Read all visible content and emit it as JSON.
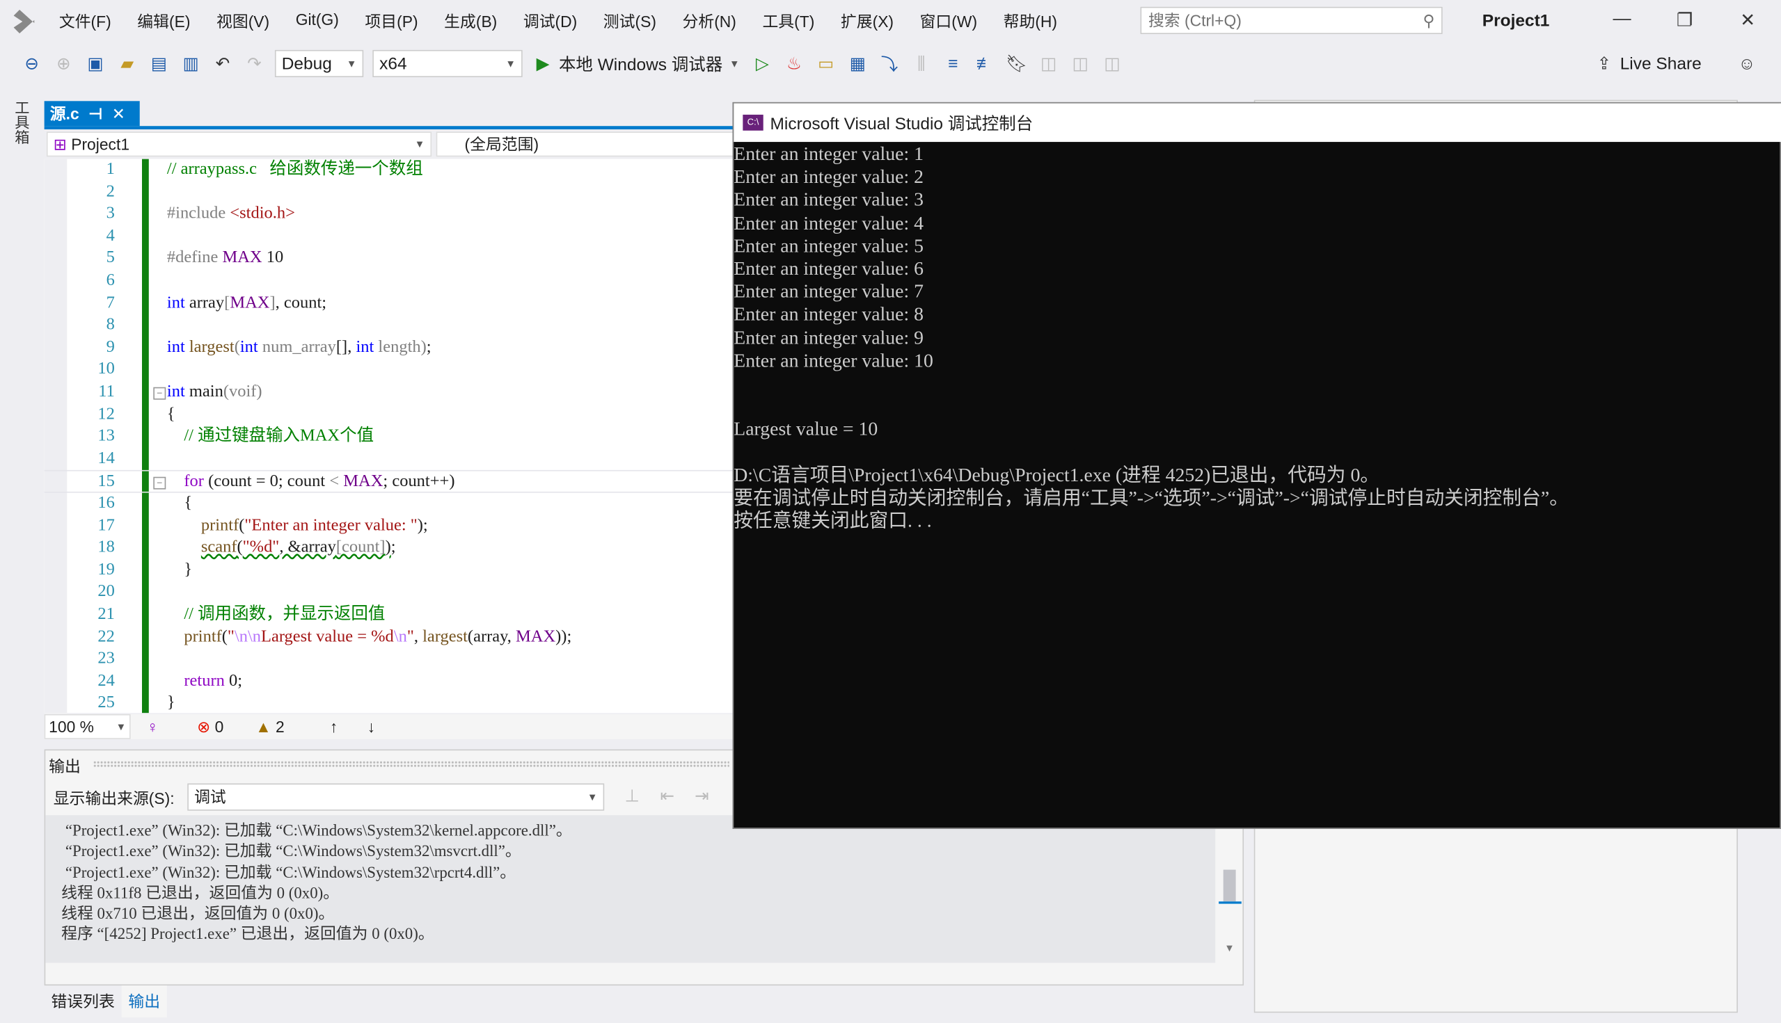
{
  "menu": [
    "文件(F)",
    "编辑(E)",
    "视图(V)",
    "Git(G)",
    "项目(P)",
    "生成(B)",
    "调试(D)",
    "测试(S)",
    "分析(N)",
    "工具(T)",
    "扩展(X)",
    "窗口(W)",
    "帮助(H)"
  ],
  "search": {
    "placeholder": "搜索 (Ctrl+Q)"
  },
  "window_title": "Project1",
  "toolbar": {
    "config": "Debug",
    "platform": "x64",
    "debugger": "本地 Windows 调试器",
    "live_share": "Live Share"
  },
  "side_toolbox": "工具箱",
  "doc_tab": {
    "label": "源.c",
    "pin": "⊣",
    "close": "✕"
  },
  "nav": {
    "project": "Project1",
    "scope": "(全局范围)"
  },
  "code_lines": [
    [
      [
        "cm",
        "// arraypass.c   给函数传递一个数组"
      ]
    ],
    [],
    [
      [
        "pp",
        "#include "
      ],
      [
        "str",
        "<stdio.h>"
      ]
    ],
    [],
    [
      [
        "pp",
        "#define "
      ],
      [
        "mac",
        "MAX"
      ],
      [
        "pl",
        " 10"
      ]
    ],
    [],
    [
      [
        "kw",
        "int"
      ],
      [
        "pl",
        " array"
      ],
      [
        "par",
        "["
      ],
      [
        "mac",
        "MAX"
      ],
      [
        "par",
        "]"
      ],
      [
        "pl",
        ", count;"
      ]
    ],
    [],
    [
      [
        "kw",
        "int"
      ],
      [
        "pl",
        " "
      ],
      [
        "fn",
        "largest"
      ],
      [
        "par",
        "("
      ],
      [
        "kw",
        "int"
      ],
      [
        "par",
        " num_array"
      ],
      [
        "pl",
        "[], "
      ],
      [
        "kw",
        "int"
      ],
      [
        "par",
        " length"
      ],
      [
        "par",
        ")"
      ],
      [
        "pl",
        ";"
      ]
    ],
    [],
    [
      [
        "kw",
        "int"
      ],
      [
        "pl",
        " main"
      ],
      [
        "par",
        "(voif)"
      ]
    ],
    [
      [
        "pl",
        "{"
      ]
    ],
    [
      [
        "pl",
        "    "
      ],
      [
        "cm",
        "// 通过键盘输入MAX个值"
      ]
    ],
    [],
    [
      [
        "pl",
        "    "
      ],
      [
        "ctl",
        "for"
      ],
      [
        "pl",
        " (count = 0; count "
      ],
      [
        "par",
        "<"
      ],
      [
        "pl",
        " "
      ],
      [
        "mac",
        "MAX"
      ],
      [
        "pl",
        "; count++)"
      ]
    ],
    [
      [
        "pl",
        "    {"
      ]
    ],
    [
      [
        "pl",
        "        "
      ],
      [
        "fn",
        "printf"
      ],
      [
        "pl",
        "("
      ],
      [
        "str",
        "\"Enter an integer value: \""
      ],
      [
        "pl",
        ");"
      ]
    ],
    [
      [
        "pl",
        "        "
      ],
      [
        "fn",
        "scanf",
        "sq"
      ],
      [
        "pl",
        "(",
        "sq"
      ],
      [
        "str",
        "\"%d\"",
        "sq"
      ],
      [
        "pl",
        ", &array",
        "sq"
      ],
      [
        "par",
        "[count]",
        "sq"
      ],
      [
        "pl",
        ")",
        "sq"
      ],
      [
        "pl",
        ";"
      ]
    ],
    [
      [
        "pl",
        "    }"
      ]
    ],
    [],
    [
      [
        "pl",
        "    "
      ],
      [
        "cm",
        "// 调用函数，并显示返回值"
      ]
    ],
    [
      [
        "pl",
        "    "
      ],
      [
        "fn",
        "printf"
      ],
      [
        "pl",
        "("
      ],
      [
        "str",
        "\""
      ],
      [
        "esc",
        "\\n\\n"
      ],
      [
        "str",
        "Largest value = %d"
      ],
      [
        "esc",
        "\\n"
      ],
      [
        "str",
        "\""
      ],
      [
        "pl",
        ", "
      ],
      [
        "fn",
        "largest"
      ],
      [
        "pl",
        "(array, "
      ],
      [
        "mac",
        "MAX"
      ],
      [
        "pl",
        "));"
      ]
    ],
    [],
    [
      [
        "pl",
        "    "
      ],
      [
        "ctl",
        "return"
      ],
      [
        "pl",
        " 0;"
      ]
    ],
    [
      [
        "pl",
        "}"
      ]
    ]
  ],
  "status": {
    "zoom": "100 %",
    "errors": "0",
    "warnings": "2"
  },
  "output": {
    "title": "输出",
    "source_label": "显示输出来源(S):",
    "source_value": "调试",
    "lines": [
      " “Project1.exe” (Win32): 已加载 “C:\\Windows\\System32\\kernel.appcore.dll”。",
      " “Project1.exe” (Win32): 已加载 “C:\\Windows\\System32\\msvcrt.dll”。",
      " “Project1.exe” (Win32): 已加载 “C:\\Windows\\System32\\rpcrt4.dll”。",
      "线程 0x11f8 已退出，返回值为 0 (0x0)。",
      "线程 0x710 已退出，返回值为 0 (0x0)。",
      "程序 “[4252] Project1.exe” 已退出，返回值为 0 (0x0)。"
    ]
  },
  "bottom_tabs": [
    {
      "label": "错误列表",
      "active": false
    },
    {
      "label": "输出",
      "active": true
    }
  ],
  "console": {
    "title": "Microsoft Visual Studio 调试控制台",
    "icon_text": "C:\\",
    "lines": [
      "Enter an integer value: 1",
      "Enter an integer value: 2",
      "Enter an integer value: 3",
      "Enter an integer value: 4",
      "Enter an integer value: 5",
      "Enter an integer value: 6",
      "Enter an integer value: 7",
      "Enter an integer value: 8",
      "Enter an integer value: 9",
      "Enter an integer value: 10",
      "",
      "",
      "Largest value = 10",
      "",
      "D:\\C语言项目\\Project1\\x64\\Debug\\Project1.exe (进程 4252)已退出，代码为 0。",
      "要在调试停止时自动关闭控制台，请启用“工具”->“选项”->“调试”->“调试停止时自动关闭控制台”。",
      "按任意键关闭此窗口. . ."
    ]
  },
  "colors": {
    "accent": "#007acc",
    "console_bg": "#0c0c0c",
    "change_bar": "#108010"
  }
}
